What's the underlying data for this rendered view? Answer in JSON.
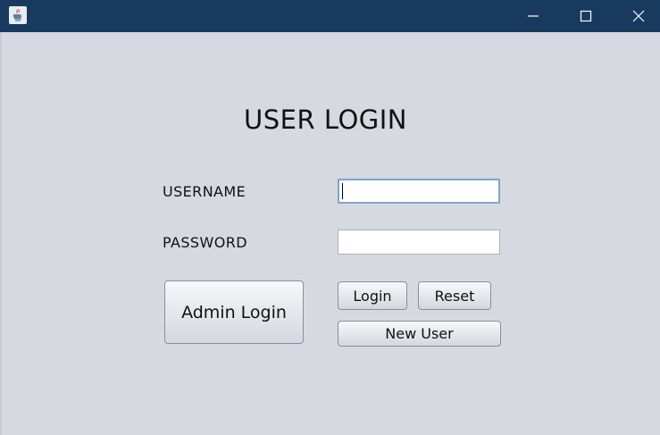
{
  "window": {
    "icon": "java-icon",
    "controls": [
      "minimize-icon",
      "maximize-icon",
      "close-icon"
    ]
  },
  "form": {
    "title": "USER LOGIN",
    "username_label": "USERNAME",
    "username_value": "",
    "password_label": "PASSWORD",
    "password_value": ""
  },
  "buttons": {
    "admin_login": "Admin Login",
    "login": "Login",
    "reset": "Reset",
    "new_user": "New User"
  },
  "colors": {
    "titlebar": "#183a5e",
    "background": "#d6d9e0",
    "focus_border": "#7fa6cc"
  }
}
